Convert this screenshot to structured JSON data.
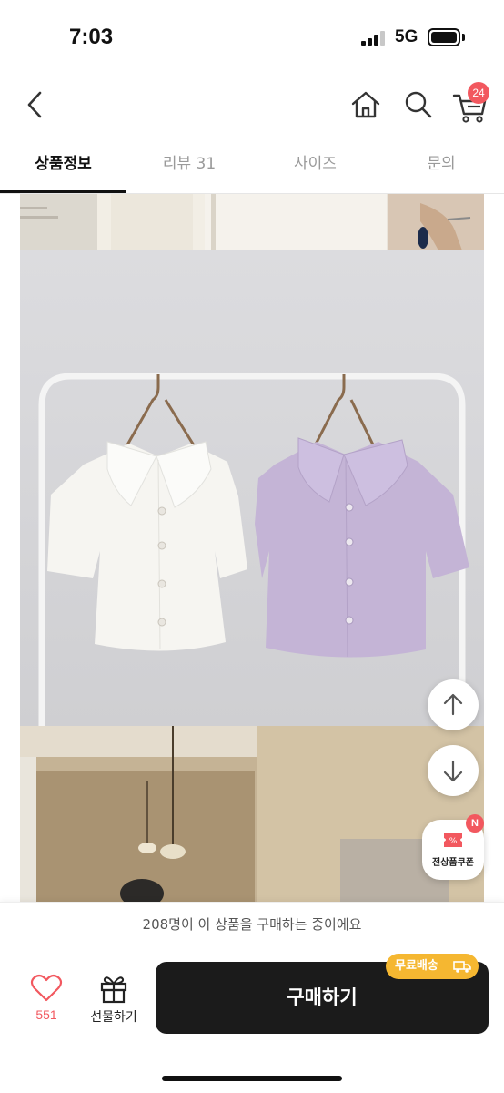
{
  "status_bar": {
    "time": "7:03",
    "network": "5G"
  },
  "header": {
    "cart_count": "24",
    "icons": [
      "chevron-left-icon",
      "home-icon",
      "search-icon",
      "cart-icon"
    ]
  },
  "tabs": [
    {
      "label": "상품정보",
      "active": true
    },
    {
      "label": "리뷰 31",
      "active": false
    },
    {
      "label": "사이즈",
      "active": false
    },
    {
      "label": "문의",
      "active": false
    }
  ],
  "coupon": {
    "label": "전상품쿠폰",
    "badge": "N"
  },
  "purchase_info": "208명이 이 상품을 구매하는 중이에요",
  "bottom_bar": {
    "like_count": "551",
    "gift_label": "선물하기",
    "buy_label": "구매하기",
    "free_shipping": "무료배송"
  },
  "colors": {
    "accent": "#f2585f",
    "buy_button": "#1b1b1b",
    "free_shipping": "#f5b731"
  }
}
